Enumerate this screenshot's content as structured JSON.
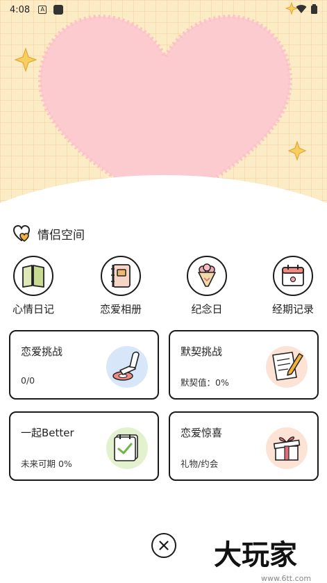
{
  "status_bar": {
    "time": "4:08",
    "icons": [
      "a-notification-icon",
      "square-notification-icon",
      "wifi-icon",
      "battery-icon"
    ]
  },
  "section": {
    "title": "情侣空间",
    "icon": "heart-badge-icon"
  },
  "quick_actions": [
    {
      "label": "心情日记",
      "icon": "book-icon"
    },
    {
      "label": "恋爱相册",
      "icon": "album-icon"
    },
    {
      "label": "纪念日",
      "icon": "bouquet-icon"
    },
    {
      "label": "经期记录",
      "icon": "calendar-icon"
    }
  ],
  "cards": [
    {
      "title": "恋爱挑战",
      "subtitle": "0/0",
      "icon": "stamp-icon"
    },
    {
      "title": "默契挑战",
      "subtitle": "默契值：0%",
      "icon": "notepad-pen-icon"
    },
    {
      "title": "一起Better",
      "subtitle": "未来可期 0%",
      "icon": "check-notepad-icon"
    },
    {
      "title": "恋爱惊喜",
      "subtitle": "礼物/约会",
      "icon": "gift-box-icon"
    }
  ],
  "footer": {
    "close_icon": "close-icon",
    "watermark_text": "大玩家",
    "watermark_site": "www.6tt.com"
  },
  "colors": {
    "hero_bg": "#fcecc6",
    "heart": "#fbcbcf",
    "blue_blob": "#d7e6f8",
    "peach_blob": "#fde3d5",
    "green_blob": "#e4f1cf"
  }
}
